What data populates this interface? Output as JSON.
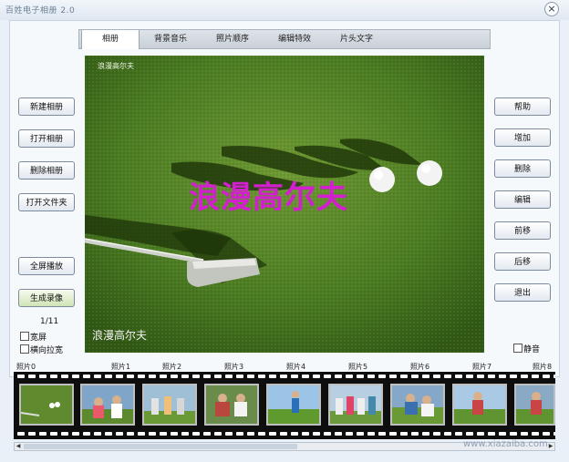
{
  "window": {
    "title": "百姓电子相册 2.0",
    "close_glyph": "×"
  },
  "tabs": [
    {
      "label": "相册",
      "active": true
    },
    {
      "label": "背景音乐",
      "active": false
    },
    {
      "label": "照片顺序",
      "active": false
    },
    {
      "label": "编辑特效",
      "active": false
    },
    {
      "label": "片头文字",
      "active": false
    }
  ],
  "preview": {
    "top_caption": "浪漫高尔夫",
    "main_caption": "浪漫高尔夫",
    "bottom_caption": "浪漫高尔夫",
    "main_caption_color": "#d41fd0"
  },
  "left_buttons": {
    "new_album": "新建相册",
    "open_album": "打开相册",
    "delete_album": "删除相册",
    "open_folder": "打开文件夹",
    "fullscreen": "全屏播放",
    "generate_video": "生成录像"
  },
  "page_counter": "1/11",
  "options": {
    "widescreen": "宽屏",
    "stretch": "横向拉宽",
    "mute": "静音"
  },
  "right_buttons": {
    "help": "帮助",
    "add": "增加",
    "delete": "删除",
    "edit": "编辑",
    "move_up": "前移",
    "move_down": "后移",
    "exit": "退出"
  },
  "filmstrip": {
    "labels": [
      "照片0",
      "照片1",
      "照片2",
      "照片3",
      "照片4",
      "照片5",
      "照片6",
      "照片7",
      "照片8"
    ]
  },
  "watermark": "www.xiazaiba.com"
}
